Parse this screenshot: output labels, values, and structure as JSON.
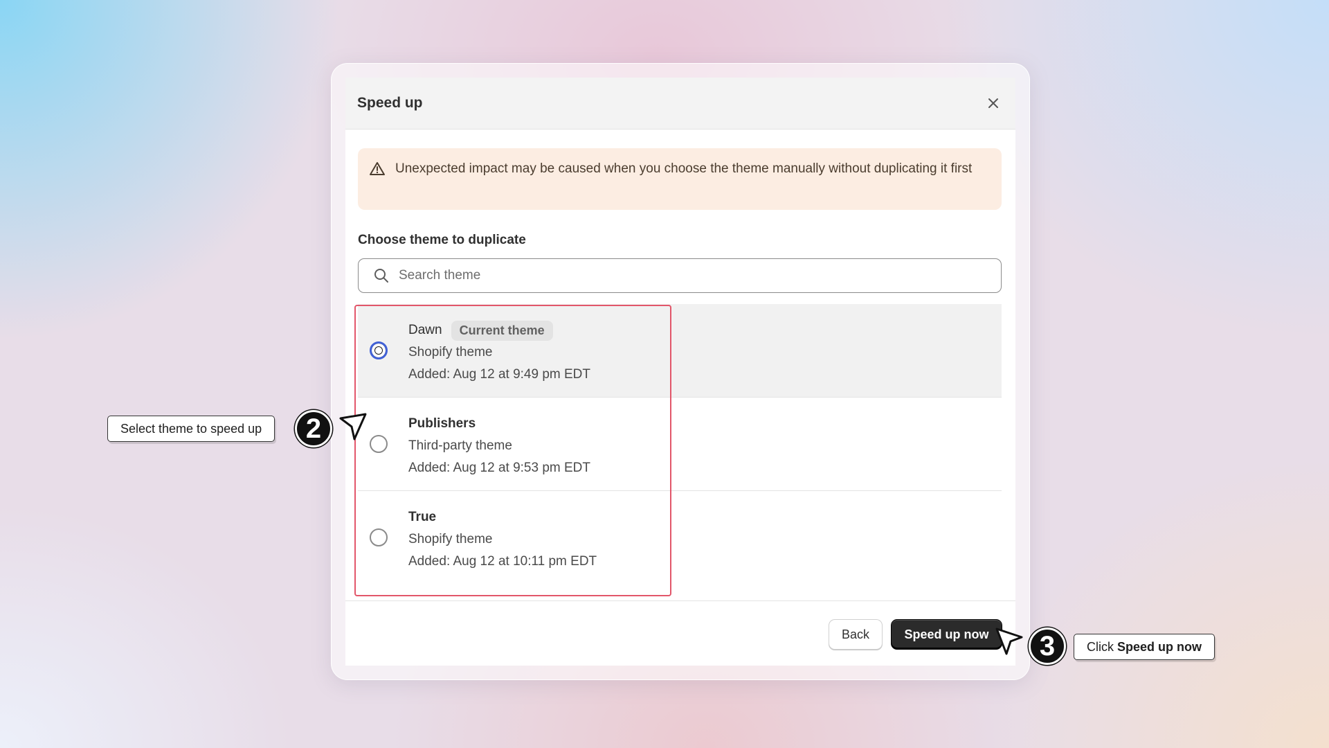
{
  "modal": {
    "title": "Speed up",
    "close_icon": "close-icon",
    "banner": {
      "icon": "warning-triangle-icon",
      "text": "Unexpected impact may be caused when you choose the theme manually without duplicating it first"
    },
    "section_label": "Choose theme to duplicate",
    "search": {
      "icon": "search-icon",
      "placeholder": "Search theme",
      "value": ""
    },
    "themes": [
      {
        "name": "Dawn",
        "badge": "Current theme",
        "type": "Shopify theme",
        "added": "Added: Aug 12 at 9:49 pm EDT",
        "selected": true
      },
      {
        "name": "Publishers",
        "type": "Third-party theme",
        "added": "Added: Aug 12 at 9:53 pm EDT",
        "selected": false
      },
      {
        "name": "True",
        "type": "Shopify theme",
        "added": "Added: Aug 12 at 10:11 pm EDT",
        "selected": false
      }
    ],
    "footer": {
      "back_label": "Back",
      "primary_label": "Speed up now"
    }
  },
  "annotations": {
    "step2": {
      "number": "2",
      "text": "Select theme to speed up"
    },
    "step3": {
      "number": "3",
      "prefix": "Click ",
      "bold": "Speed up now"
    },
    "highlight_color": "#e2566a"
  }
}
